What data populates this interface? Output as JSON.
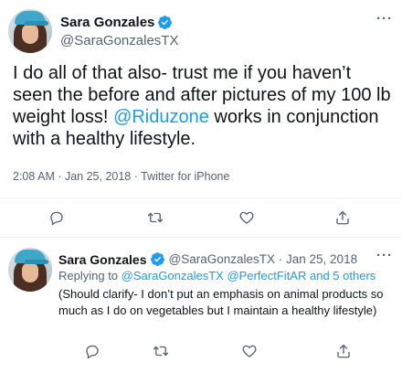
{
  "tweet": {
    "author_name": "Sara Gonzales",
    "author_handle": "@SaraGonzalesTX",
    "more_icon": "more-horizontal-icon",
    "text_parts": [
      "I do all of that also- trust me if you haven’t seen the before and after pictures of my 100 lb weight loss! ",
      "@Riduzone",
      " works in conjunction with a healthy lifestyle."
    ],
    "timestamp": "2:08 AM · Jan 25, 2018",
    "separator": " · ",
    "source": "Twitter for iPhone",
    "actions": [
      "reply-icon",
      "retweet-icon",
      "like-icon",
      "share-icon"
    ]
  },
  "reply": {
    "author_name": "Sara Gonzales",
    "author_handle": "@SaraGonzalesTX",
    "date": "Jan 25, 2018",
    "dot": " · ",
    "replying_prefix": "Replying to ",
    "replying_handle_1": "@SaraGonzalesTX",
    "replying_handle_2": "@PerfectFitAR",
    "replying_others": "and 5 others",
    "text": "(Should clarify- I don’t put an emphasis on animal products so much as I do on vegetables but I maintain a healthy lifestyle)",
    "more_icon": "more-horizontal-icon",
    "actions": [
      "reply-icon",
      "retweet-icon",
      "like-icon",
      "share-icon"
    ]
  },
  "colors": {
    "link": "#1d9bf0",
    "text": "#0f1419",
    "secondary": "#536471",
    "divider": "#eff3f4",
    "verified": "#1d9bf0"
  }
}
